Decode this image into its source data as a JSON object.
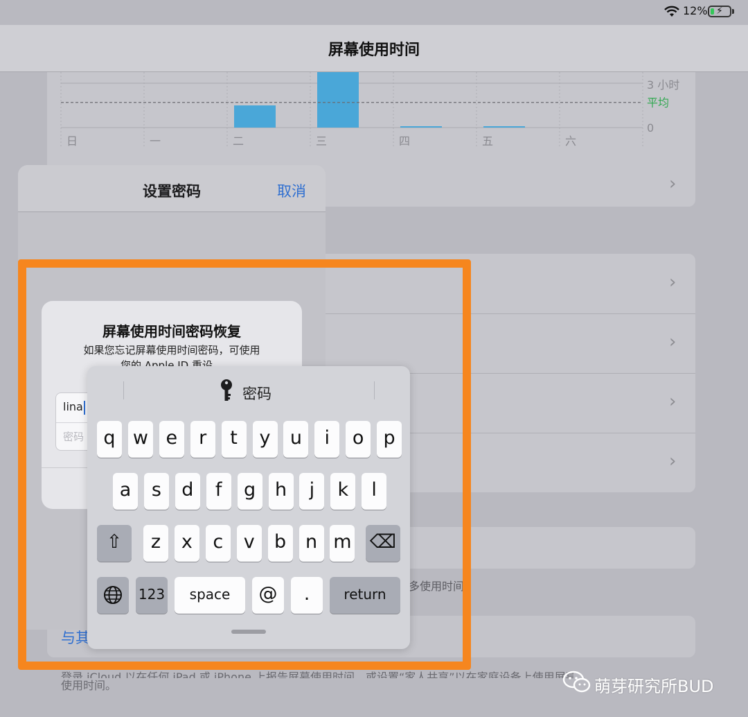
{
  "status_bar": {
    "battery_percent": "12%",
    "icons": [
      "wifi-icon",
      "battery-charging-icon"
    ]
  },
  "nav": {
    "title": "屏幕使用时间"
  },
  "chart_data": {
    "type": "bar",
    "categories": [
      "日",
      "一",
      "二",
      "三",
      "四",
      "五",
      "六"
    ],
    "values": [
      0,
      0,
      1.5,
      4.2,
      0.05,
      0.05,
      0
    ],
    "y_tick_labels": [
      "3 小时",
      "0"
    ],
    "average_label": "平均",
    "average_value": 1.7,
    "ylim": [
      0,
      3
    ],
    "bar_color": "#4aa7d8",
    "average_color": "#34a853",
    "grid": true
  },
  "dialog": {
    "title": "设置密码",
    "cancel_label": "取消"
  },
  "recovery": {
    "title": "屏幕使用时间密码恢复",
    "description_line1": "如果您忘记屏幕使用时间密码，可使用",
    "description_line2": "您的 Apple ID 重设。",
    "username_value": "lina",
    "password_placeholder": "密码"
  },
  "keyboard": {
    "field_label": "密码",
    "row1": [
      "q",
      "w",
      "e",
      "r",
      "t",
      "y",
      "u",
      "i",
      "o",
      "p"
    ],
    "row2": [
      "a",
      "s",
      "d",
      "f",
      "g",
      "h",
      "j",
      "k",
      "l"
    ],
    "row3": [
      "z",
      "x",
      "c",
      "v",
      "b",
      "n",
      "m"
    ],
    "shift_icon": "⇧",
    "delete_icon": "⌫",
    "globe_icon": "🌐",
    "numbers_label": "123",
    "space_label": "space",
    "at_label": "@",
    "dot_label": ".",
    "return_label": "return"
  },
  "background": {
    "partial_text": "多使用时间。",
    "family_link": "与其",
    "footer_line1": "登录 iCloud 以在任何 iPad 或 iPhone 上报告屏幕使用时间，或设置“家人共享”以在家庭设备上使用屏幕",
    "footer_line2": "使用时间。"
  },
  "watermark": {
    "text": "萌芽研究所BUD"
  },
  "colors": {
    "highlight_border": "#f6861e",
    "link_blue": "#2f6fd0"
  }
}
